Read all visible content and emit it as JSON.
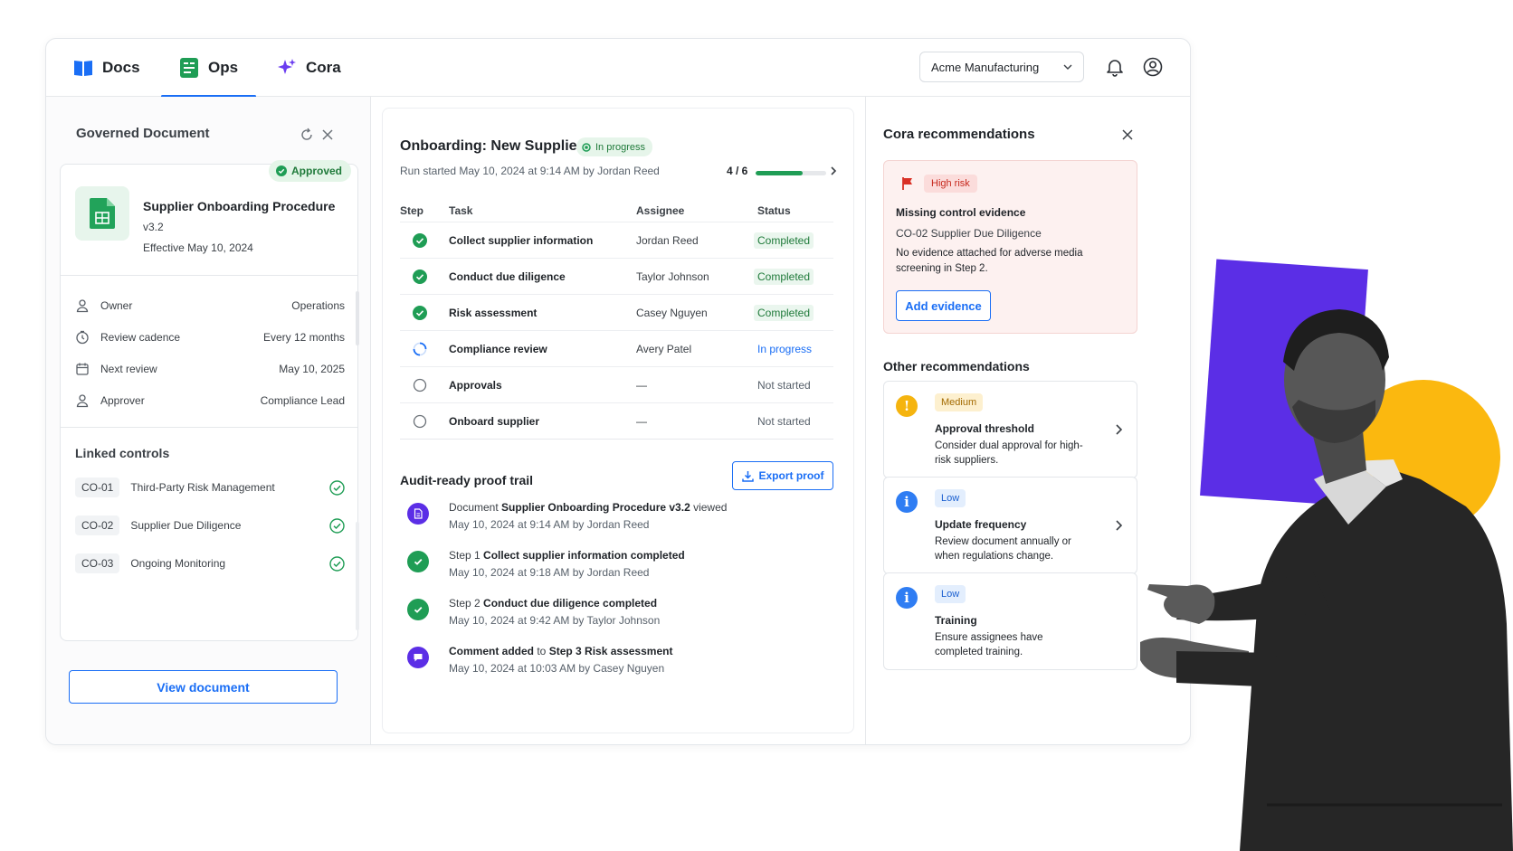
{
  "nav": {
    "tabs": [
      {
        "label": "Docs",
        "icon": "book-icon",
        "active": false
      },
      {
        "label": "Ops",
        "icon": "ops-board-icon",
        "active": true
      },
      {
        "label": "Cora",
        "icon": "sparkle-icon",
        "active": false
      }
    ],
    "org_select": "Acme Manufacturing"
  },
  "document_panel": {
    "title": "Governed Document",
    "status_badge": "Approved",
    "doc_name": "Supplier Onboarding Procedure",
    "version": "v3.2",
    "effective": "Effective May 10, 2024",
    "meta": [
      {
        "label": "Owner",
        "value": "Operations",
        "icon": "person-icon"
      },
      {
        "label": "Review cadence",
        "value": "Every 12 months",
        "icon": "clock-refresh-icon"
      },
      {
        "label": "Next review",
        "value": "May 10, 2025",
        "icon": "calendar-icon"
      },
      {
        "label": "Approver",
        "value": "Compliance Lead",
        "icon": "person-icon"
      }
    ],
    "linked_controls_title": "Linked controls",
    "linked_controls": [
      {
        "code": "CO-01",
        "name": "Third-Party Risk Management"
      },
      {
        "code": "CO-02",
        "name": "Supplier Due Diligence"
      },
      {
        "code": "CO-03",
        "name": "Ongoing Monitoring"
      }
    ],
    "view_button": "View document"
  },
  "workflow": {
    "title": "Onboarding: New Supplier",
    "status_badge": "In progress",
    "run_info": "Run started May 10, 2024 at 9:14 AM by Jordan Reed",
    "progress_label": "4 / 6",
    "progress_fraction": 0.667,
    "columns": {
      "step": "Step",
      "task": "Task",
      "assignee": "Assignee",
      "status": "Status"
    },
    "tasks": [
      {
        "task": "Collect supplier information",
        "assignee": "Jordan Reed",
        "status": "Completed",
        "state": "done"
      },
      {
        "task": "Conduct due diligence",
        "assignee": "Taylor Johnson",
        "status": "Completed",
        "state": "done"
      },
      {
        "task": "Risk assessment",
        "assignee": "Casey Nguyen",
        "status": "Completed",
        "state": "done"
      },
      {
        "task": "Compliance review",
        "assignee": "Avery Patel",
        "status": "In progress",
        "state": "progress"
      },
      {
        "task": "Approvals",
        "assignee": "—",
        "status": "Not started",
        "state": "none"
      },
      {
        "task": "Onboard supplier",
        "assignee": "—",
        "status": "Not started",
        "state": "none"
      }
    ],
    "audit_title": "Audit-ready proof trail",
    "export_button": "Export proof",
    "events": [
      {
        "pre": "Document ",
        "bold": "Supplier Onboarding Procedure v3.2",
        "post": " viewed",
        "meta": "May 10, 2024 at 9:14 AM by Jordan Reed",
        "kind": "document"
      },
      {
        "pre": "Step 1 ",
        "bold": "Collect supplier information completed",
        "post": "",
        "meta": "May 10, 2024 at 9:18 AM by Jordan Reed",
        "kind": "check"
      },
      {
        "pre": "Step 2 ",
        "bold": "Conduct due diligence completed",
        "post": "",
        "meta": "May 10, 2024 at 9:42 AM by Taylor Johnson",
        "kind": "check"
      },
      {
        "pre": "",
        "bold": "Comment added",
        "post": " to ",
        "bold2": "Step 3 Risk assessment",
        "meta": "May 10, 2024 at 10:03 AM by Casey Nguyen",
        "kind": "comment"
      }
    ]
  },
  "recommendations": {
    "title": "Cora recommendations",
    "primary": {
      "badge": "High risk",
      "heading": "Missing control evidence",
      "control": "CO-02 Supplier Due Diligence",
      "description": "No evidence attached for adverse media screening in Step 2.",
      "button": "Add evidence"
    },
    "other_title": "Other recommendations",
    "others": [
      {
        "badge": "Medium",
        "heading": "Approval threshold",
        "description": "Consider dual approval for high-risk suppliers.",
        "icon": "warning-icon",
        "glyph": "!",
        "color": "#f5b40f",
        "badge_bg": "#fdf0cf",
        "badge_fg": "#a36a00",
        "chevron": true
      },
      {
        "badge": "Low",
        "heading": "Update frequency",
        "description": "Review document annually or when regulations change.",
        "icon": "info-icon",
        "glyph": "i",
        "color": "#2f7df3",
        "badge_bg": "#e3eefd",
        "badge_fg": "#1a5fd0",
        "chevron": true
      },
      {
        "badge": "Low",
        "heading": "Training",
        "description": "Ensure assignees have completed training.",
        "icon": "info-icon",
        "glyph": "i",
        "color": "#2f7df3",
        "badge_bg": "#e3eefd",
        "badge_fg": "#1a5fd0",
        "chevron": false
      }
    ]
  },
  "colors": {
    "accent": "#1a6ef5",
    "success": "#1f9d55",
    "danger": "#d93025",
    "purple": "#5b2ee6",
    "yellow": "#fbb80f"
  }
}
